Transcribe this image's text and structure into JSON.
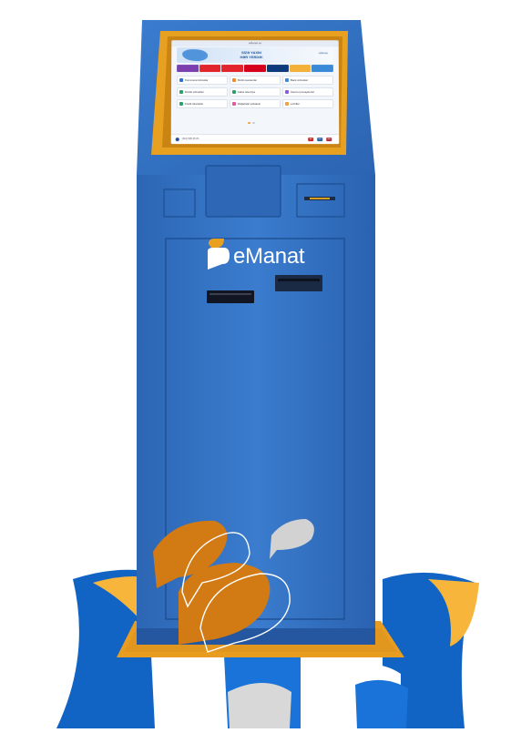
{
  "brand": {
    "name": "eManat"
  },
  "screen": {
    "topbar": "eManat.az",
    "banner": {
      "line1": "SİZƏ YAXIN",
      "line2": "HƏR YERDƏ!",
      "logo": "eManat"
    },
    "providers": [
      {
        "label": "",
        "color": "#7b3fb0"
      },
      {
        "label": "",
        "color": "#e2242c"
      },
      {
        "label": "",
        "color": "#e2242c"
      },
      {
        "label": "",
        "color": "#d6001c"
      },
      {
        "label": "",
        "color": "#0d3a7a"
      },
      {
        "label": "",
        "color": "#f3b13a"
      },
      {
        "label": "",
        "color": "#3a8ad8"
      }
    ],
    "tiles": [
      {
        "label": "Kommunal xidmətlər",
        "icon": "house-icon",
        "color": "#2f6fd0"
      },
      {
        "label": "Mobil operatorlar",
        "icon": "phone-icon",
        "color": "#f08a2a"
      },
      {
        "label": "Bank xidmətləri",
        "icon": "bank-icon",
        "color": "#3a8ad8"
      },
      {
        "label": "Dövlət xidmətləri",
        "icon": "gov-icon",
        "color": "#2aa06a"
      },
      {
        "label": "Kabel televiziya",
        "icon": "tv-icon",
        "color": "#2aa06a"
      },
      {
        "label": "İnternet provayderləri",
        "icon": "globe-icon",
        "color": "#8a5ad8"
      },
      {
        "label": "Kredit ödənişləri",
        "icon": "credit-icon",
        "color": "#2aa06a"
      },
      {
        "label": "Mağazalar şəbəkəsi",
        "icon": "store-icon",
        "color": "#e25a9a"
      },
      {
        "label": "e-Pullar",
        "icon": "wallet-icon",
        "color": "#f0a040"
      }
    ],
    "bottom": {
      "phone": "(012) 505 25 25",
      "languages": [
        "AZ",
        "RU",
        "EN"
      ]
    }
  },
  "colors": {
    "kiosk_blue": "#2f6fbf",
    "kiosk_dark": "#1f549a",
    "frame_orange": "#e8a020",
    "accent_orange": "#d27a14",
    "accent_yellow": "#f7b53c",
    "wave_blue": "#1264c4"
  }
}
